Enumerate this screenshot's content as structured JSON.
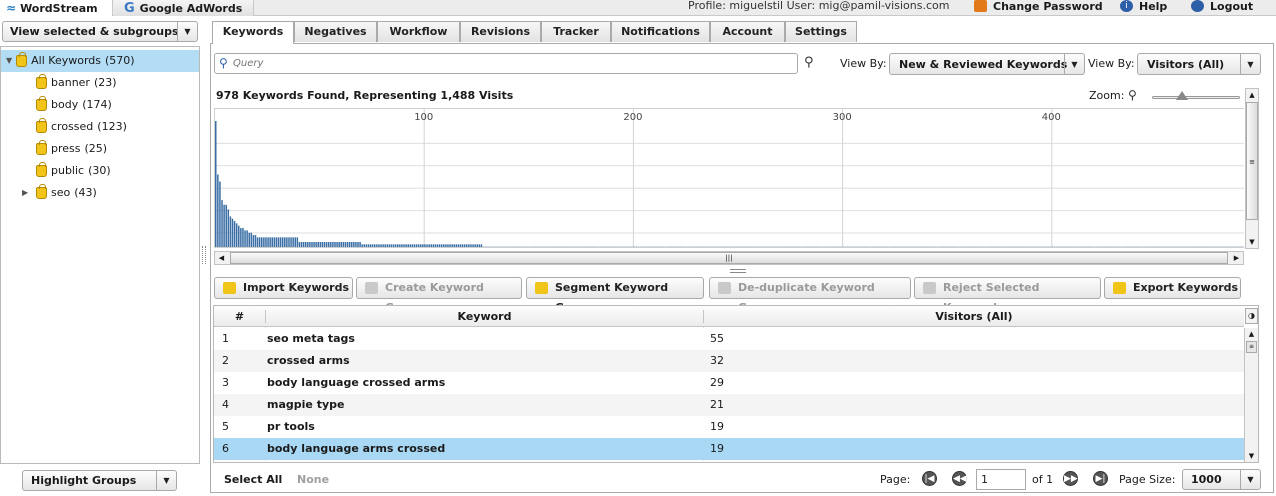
{
  "top_tabs": [
    {
      "label": "WordStream",
      "active": true
    },
    {
      "label": "Google AdWords",
      "active": false
    }
  ],
  "header": {
    "profile_text": "Profile: miguelstil User: mig@pamil-visions.com",
    "change_password": "Change Password",
    "help": "Help",
    "logout": "Logout"
  },
  "sidebar": {
    "view_selector": "View selected & subgroups",
    "root": {
      "label": "All Keywords",
      "count": "(570)"
    },
    "items": [
      {
        "label": "banner",
        "count": "(23)"
      },
      {
        "label": "body",
        "count": "(174)"
      },
      {
        "label": "crossed",
        "count": "(123)"
      },
      {
        "label": "press",
        "count": "(25)"
      },
      {
        "label": "public",
        "count": "(30)"
      },
      {
        "label": "seo",
        "count": "(43)"
      }
    ],
    "highlight_groups": "Highlight Groups"
  },
  "main_tabs": [
    "Keywords",
    "Negatives",
    "Workflow",
    "Revisions",
    "Tracker",
    "Notifications",
    "Account",
    "Settings"
  ],
  "search": {
    "placeholder": "Query"
  },
  "view_by_1": {
    "label": "View By:",
    "value": "New & Reviewed Keywords"
  },
  "view_by_2": {
    "label": "View By:",
    "value": "Visitors (All)"
  },
  "summary": "978 Keywords Found, Representing 1,488 Visits",
  "zoom_label": "Zoom:",
  "zoom_level": 0.33,
  "chart_data": {
    "type": "bar",
    "x_ticks": [
      "100",
      "200",
      "300",
      "400"
    ],
    "xlim": [
      0,
      495
    ],
    "values_top": [
      55,
      32,
      29,
      21,
      19,
      19,
      17,
      14,
      13,
      12,
      11,
      10,
      9,
      9,
      8,
      8,
      7,
      7,
      6,
      6
    ],
    "tail_levels": [
      {
        "from": 20,
        "to": 40,
        "value": 5
      },
      {
        "from": 40,
        "to": 70,
        "value": 3
      },
      {
        "from": 70,
        "to": 128,
        "value": 2
      },
      {
        "from": 128,
        "to": 495,
        "value": 1
      }
    ]
  },
  "toolbar": [
    {
      "label": "Import Keywords",
      "enabled": true
    },
    {
      "label": "Create Keyword Group",
      "enabled": false
    },
    {
      "label": "Segment Keyword Group",
      "enabled": true
    },
    {
      "label": "De-duplicate Keyword Group",
      "enabled": false
    },
    {
      "label": "Reject Selected Keywords",
      "enabled": false
    },
    {
      "label": "Export Keywords",
      "enabled": true
    }
  ],
  "table": {
    "headers": [
      "#",
      "Keyword",
      "Visitors (All)"
    ],
    "rows": [
      {
        "n": "1",
        "keyword": "seo meta tags",
        "visitors": "55"
      },
      {
        "n": "2",
        "keyword": "crossed arms",
        "visitors": "32"
      },
      {
        "n": "3",
        "keyword": "body language crossed arms",
        "visitors": "29"
      },
      {
        "n": "4",
        "keyword": "magpie type",
        "visitors": "21"
      },
      {
        "n": "5",
        "keyword": "pr tools",
        "visitors": "19"
      },
      {
        "n": "6",
        "keyword": "body language arms crossed",
        "visitors": "19"
      }
    ],
    "selected_row": 5
  },
  "footer": {
    "select_all": "Select All",
    "none": "None",
    "page_label": "Page:",
    "page_value": "1",
    "of_text": "of 1",
    "page_size_label": "Page Size:",
    "page_size_value": "1000"
  },
  "colors": {
    "accent": "#b3dcf5",
    "bar": "#3a6ea5",
    "selected": "#a9d8f5"
  }
}
